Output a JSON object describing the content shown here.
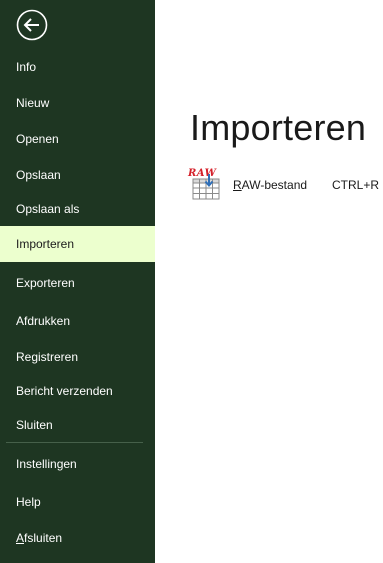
{
  "sidebar": {
    "items": [
      {
        "label": "Info"
      },
      {
        "label": "Nieuw"
      },
      {
        "label": "Openen"
      },
      {
        "label": "Opslaan"
      },
      {
        "label": "Opslaan als"
      },
      {
        "label": "Importeren",
        "active": true
      },
      {
        "label": "Exporteren"
      },
      {
        "label": "Afdrukken"
      },
      {
        "label": "Registreren"
      },
      {
        "label": "Bericht verzenden"
      },
      {
        "label": "Sluiten"
      },
      {
        "label": "Instellingen"
      },
      {
        "label": "Help"
      },
      {
        "label_underlined": "A",
        "label_rest": "fsluiten"
      }
    ]
  },
  "main": {
    "title": "Importeren",
    "options": [
      {
        "icon": "raw-file-icon",
        "icon_text": "RAW",
        "label_underlined": "R",
        "label_rest": "AW-bestand",
        "shortcut": "CTRL+R"
      }
    ]
  },
  "colors": {
    "sidebar_bg": "#1e3622",
    "active_item_bg": "#ecffce",
    "raw_red": "#d4202a",
    "import_arrow_blue": "#2f6fb8"
  }
}
